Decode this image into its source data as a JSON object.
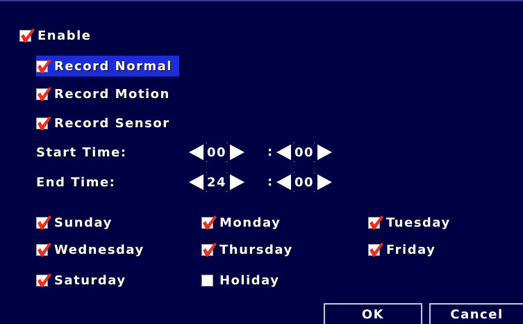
{
  "enable": {
    "label": "Enable",
    "checked": true
  },
  "record_options": [
    {
      "label": "Record Normal",
      "checked": true,
      "selected": true
    },
    {
      "label": "Record Motion",
      "checked": true,
      "selected": false
    },
    {
      "label": "Record Sensor",
      "checked": true,
      "selected": false
    }
  ],
  "start_time": {
    "label": "Start Time:",
    "hour": "00",
    "minute": "00"
  },
  "end_time": {
    "label": "End Time:",
    "hour": "24",
    "minute": "00"
  },
  "time_separator": ":",
  "days": [
    {
      "label": "Sunday",
      "checked": true
    },
    {
      "label": "Monday",
      "checked": true
    },
    {
      "label": "Tuesday",
      "checked": true
    },
    {
      "label": "Wednesday",
      "checked": true
    },
    {
      "label": "Thursday",
      "checked": true
    },
    {
      "label": "Friday",
      "checked": true
    },
    {
      "label": "Saturday",
      "checked": true
    },
    {
      "label": "Holiday",
      "checked": false
    }
  ],
  "buttons": {
    "ok": "OK",
    "cancel": "Cancel"
  },
  "colors": {
    "background": "#000044",
    "selection": "#1c2cd8",
    "check_mark": "#e83020",
    "text": "#ffffff"
  }
}
